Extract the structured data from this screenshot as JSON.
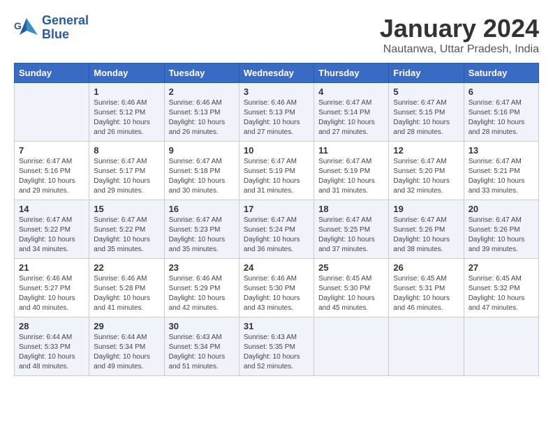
{
  "logo": {
    "line1": "General",
    "line2": "Blue"
  },
  "title": "January 2024",
  "subtitle": "Nautanwa, Uttar Pradesh, India",
  "days_of_week": [
    "Sunday",
    "Monday",
    "Tuesday",
    "Wednesday",
    "Thursday",
    "Friday",
    "Saturday"
  ],
  "weeks": [
    [
      {
        "day": "",
        "info": ""
      },
      {
        "day": "1",
        "info": "Sunrise: 6:46 AM\nSunset: 5:12 PM\nDaylight: 10 hours\nand 26 minutes."
      },
      {
        "day": "2",
        "info": "Sunrise: 6:46 AM\nSunset: 5:13 PM\nDaylight: 10 hours\nand 26 minutes."
      },
      {
        "day": "3",
        "info": "Sunrise: 6:46 AM\nSunset: 5:13 PM\nDaylight: 10 hours\nand 27 minutes."
      },
      {
        "day": "4",
        "info": "Sunrise: 6:47 AM\nSunset: 5:14 PM\nDaylight: 10 hours\nand 27 minutes."
      },
      {
        "day": "5",
        "info": "Sunrise: 6:47 AM\nSunset: 5:15 PM\nDaylight: 10 hours\nand 28 minutes."
      },
      {
        "day": "6",
        "info": "Sunrise: 6:47 AM\nSunset: 5:16 PM\nDaylight: 10 hours\nand 28 minutes."
      }
    ],
    [
      {
        "day": "7",
        "info": "Sunrise: 6:47 AM\nSunset: 5:16 PM\nDaylight: 10 hours\nand 29 minutes."
      },
      {
        "day": "8",
        "info": "Sunrise: 6:47 AM\nSunset: 5:17 PM\nDaylight: 10 hours\nand 29 minutes."
      },
      {
        "day": "9",
        "info": "Sunrise: 6:47 AM\nSunset: 5:18 PM\nDaylight: 10 hours\nand 30 minutes."
      },
      {
        "day": "10",
        "info": "Sunrise: 6:47 AM\nSunset: 5:19 PM\nDaylight: 10 hours\nand 31 minutes."
      },
      {
        "day": "11",
        "info": "Sunrise: 6:47 AM\nSunset: 5:19 PM\nDaylight: 10 hours\nand 31 minutes."
      },
      {
        "day": "12",
        "info": "Sunrise: 6:47 AM\nSunset: 5:20 PM\nDaylight: 10 hours\nand 32 minutes."
      },
      {
        "day": "13",
        "info": "Sunrise: 6:47 AM\nSunset: 5:21 PM\nDaylight: 10 hours\nand 33 minutes."
      }
    ],
    [
      {
        "day": "14",
        "info": "Sunrise: 6:47 AM\nSunset: 5:22 PM\nDaylight: 10 hours\nand 34 minutes."
      },
      {
        "day": "15",
        "info": "Sunrise: 6:47 AM\nSunset: 5:22 PM\nDaylight: 10 hours\nand 35 minutes."
      },
      {
        "day": "16",
        "info": "Sunrise: 6:47 AM\nSunset: 5:23 PM\nDaylight: 10 hours\nand 35 minutes."
      },
      {
        "day": "17",
        "info": "Sunrise: 6:47 AM\nSunset: 5:24 PM\nDaylight: 10 hours\nand 36 minutes."
      },
      {
        "day": "18",
        "info": "Sunrise: 6:47 AM\nSunset: 5:25 PM\nDaylight: 10 hours\nand 37 minutes."
      },
      {
        "day": "19",
        "info": "Sunrise: 6:47 AM\nSunset: 5:26 PM\nDaylight: 10 hours\nand 38 minutes."
      },
      {
        "day": "20",
        "info": "Sunrise: 6:47 AM\nSunset: 5:26 PM\nDaylight: 10 hours\nand 39 minutes."
      }
    ],
    [
      {
        "day": "21",
        "info": "Sunrise: 6:46 AM\nSunset: 5:27 PM\nDaylight: 10 hours\nand 40 minutes."
      },
      {
        "day": "22",
        "info": "Sunrise: 6:46 AM\nSunset: 5:28 PM\nDaylight: 10 hours\nand 41 minutes."
      },
      {
        "day": "23",
        "info": "Sunrise: 6:46 AM\nSunset: 5:29 PM\nDaylight: 10 hours\nand 42 minutes."
      },
      {
        "day": "24",
        "info": "Sunrise: 6:46 AM\nSunset: 5:30 PM\nDaylight: 10 hours\nand 43 minutes."
      },
      {
        "day": "25",
        "info": "Sunrise: 6:45 AM\nSunset: 5:30 PM\nDaylight: 10 hours\nand 45 minutes."
      },
      {
        "day": "26",
        "info": "Sunrise: 6:45 AM\nSunset: 5:31 PM\nDaylight: 10 hours\nand 46 minutes."
      },
      {
        "day": "27",
        "info": "Sunrise: 6:45 AM\nSunset: 5:32 PM\nDaylight: 10 hours\nand 47 minutes."
      }
    ],
    [
      {
        "day": "28",
        "info": "Sunrise: 6:44 AM\nSunset: 5:33 PM\nDaylight: 10 hours\nand 48 minutes."
      },
      {
        "day": "29",
        "info": "Sunrise: 6:44 AM\nSunset: 5:34 PM\nDaylight: 10 hours\nand 49 minutes."
      },
      {
        "day": "30",
        "info": "Sunrise: 6:43 AM\nSunset: 5:34 PM\nDaylight: 10 hours\nand 51 minutes."
      },
      {
        "day": "31",
        "info": "Sunrise: 6:43 AM\nSunset: 5:35 PM\nDaylight: 10 hours\nand 52 minutes."
      },
      {
        "day": "",
        "info": ""
      },
      {
        "day": "",
        "info": ""
      },
      {
        "day": "",
        "info": ""
      }
    ]
  ]
}
